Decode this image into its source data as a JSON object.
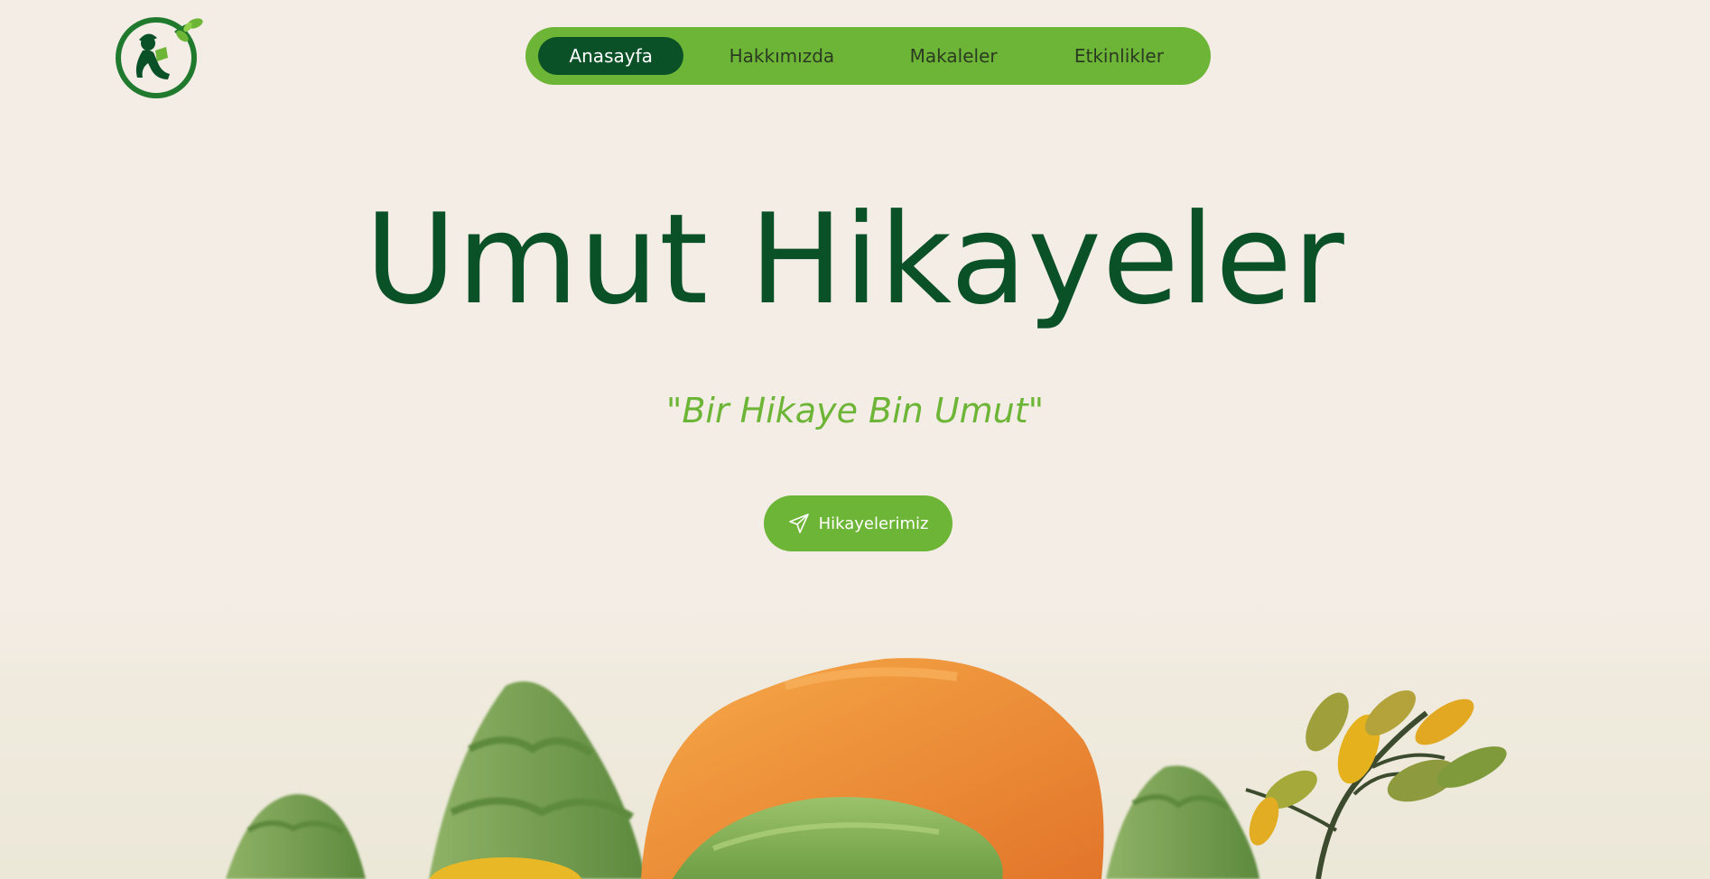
{
  "nav": {
    "items": [
      {
        "label": "Anasayfa",
        "active": true
      },
      {
        "label": "Hakkımızda",
        "active": false
      },
      {
        "label": "Makaleler",
        "active": false
      },
      {
        "label": "Etkinlikler",
        "active": false
      }
    ]
  },
  "hero": {
    "title": "Umut Hikayeler",
    "subtitle": "\"Bir Hikaye Bin Umut\"",
    "cta_label": "Hikayelerimiz",
    "cta_icon": "paper-plane-icon"
  },
  "logo": {
    "icon": "child-reading-leaf-logo"
  },
  "colors": {
    "background": "#f4ede6",
    "brand_green": "#6db536",
    "dark_green": "#0b5128",
    "orange": "#ee8a2c",
    "yellow": "#e9b826"
  }
}
